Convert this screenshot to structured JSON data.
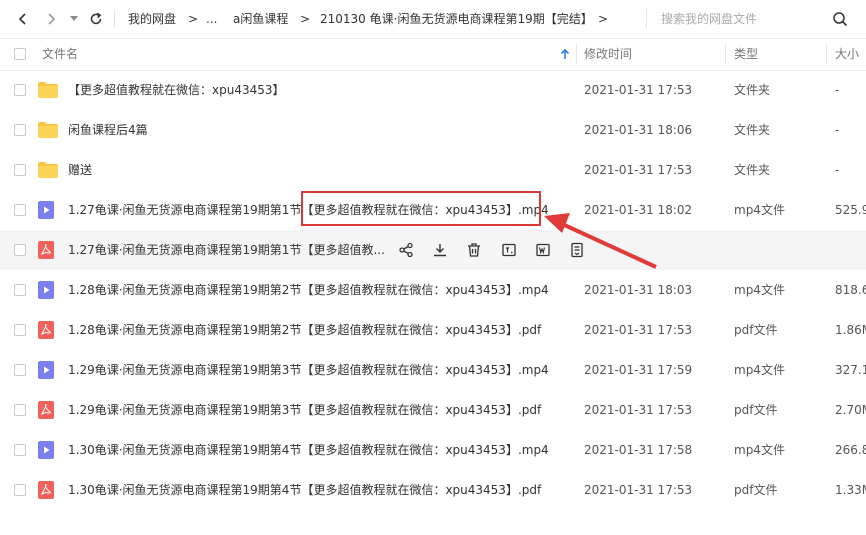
{
  "breadcrumb": {
    "root": "我的网盘",
    "sep": ">",
    "ellipsis": "...",
    "folder1": "a闲鱼课程",
    "folder2": "210130 龟课·闲鱼无货源电商课程第19期【完结】"
  },
  "search": {
    "placeholder": "搜索我的网盘文件"
  },
  "columns": {
    "name": "文件名",
    "time": "修改时间",
    "type": "类型",
    "size": "大小"
  },
  "rows": [
    {
      "name": "【更多超值教程就在微信：xpu43453】",
      "time": "2021-01-31 17:53",
      "type": "文件夹",
      "size": "-",
      "icon": "folder-icon"
    },
    {
      "name": "闲鱼课程后4篇",
      "time": "2021-01-31 18:06",
      "type": "文件夹",
      "size": "-",
      "icon": "folder-icon"
    },
    {
      "name": "赠送",
      "time": "2021-01-31 17:53",
      "type": "文件夹",
      "size": "-",
      "icon": "folder-icon"
    },
    {
      "name": "1.27龟课·闲鱼无货源电商课程第19期第1节【更多超值教程就在微信：xpu43453】.mp4",
      "time": "2021-01-31 18:02",
      "type": "mp4文件",
      "size": "525.9",
      "icon": "video-icon"
    },
    {
      "name": "1.27龟课·闲鱼无货源电商课程第19期第1节【更多超值教...",
      "time": "",
      "type": "",
      "size": "",
      "icon": "pdf-icon"
    },
    {
      "name": "1.28龟课·闲鱼无货源电商课程第19期第2节【更多超值教程就在微信：xpu43453】.mp4",
      "time": "2021-01-31 18:03",
      "type": "mp4文件",
      "size": "818.6",
      "icon": "video-icon"
    },
    {
      "name": "1.28龟课·闲鱼无货源电商课程第19期第2节【更多超值教程就在微信：xpu43453】.pdf",
      "time": "2021-01-31 17:53",
      "type": "pdf文件",
      "size": "1.86M",
      "icon": "pdf-icon"
    },
    {
      "name": "1.29龟课·闲鱼无货源电商课程第19期第3节【更多超值教程就在微信：xpu43453】.mp4",
      "time": "2021-01-31 17:59",
      "type": "mp4文件",
      "size": "327.1",
      "icon": "video-icon"
    },
    {
      "name": "1.29龟课·闲鱼无货源电商课程第19期第3节【更多超值教程就在微信：xpu43453】.pdf",
      "time": "2021-01-31 17:53",
      "type": "pdf文件",
      "size": "2.70M",
      "icon": "pdf-icon"
    },
    {
      "name": "1.30龟课·闲鱼无货源电商课程第19期第4节【更多超值教程就在微信：xpu43453】.mp4",
      "time": "2021-01-31 17:58",
      "type": "mp4文件",
      "size": "266.8",
      "icon": "video-icon"
    },
    {
      "name": "1.30龟课·闲鱼无货源电商课程第19期第4节【更多超值教程就在微信：xpu43453】.pdf",
      "time": "2021-01-31 17:53",
      "type": "pdf文件",
      "size": "1.33M",
      "icon": "pdf-icon"
    }
  ],
  "hover_actions": [
    "share-icon",
    "download-icon",
    "delete-icon",
    "rename-icon",
    "word-icon",
    "more-icon"
  ],
  "colors": {
    "folder": "#f7c844",
    "video": "#7b7ef0",
    "pdf": "#f0625c",
    "highlight": "#d83a3a",
    "sort_arrow": "#2f7cf6"
  }
}
